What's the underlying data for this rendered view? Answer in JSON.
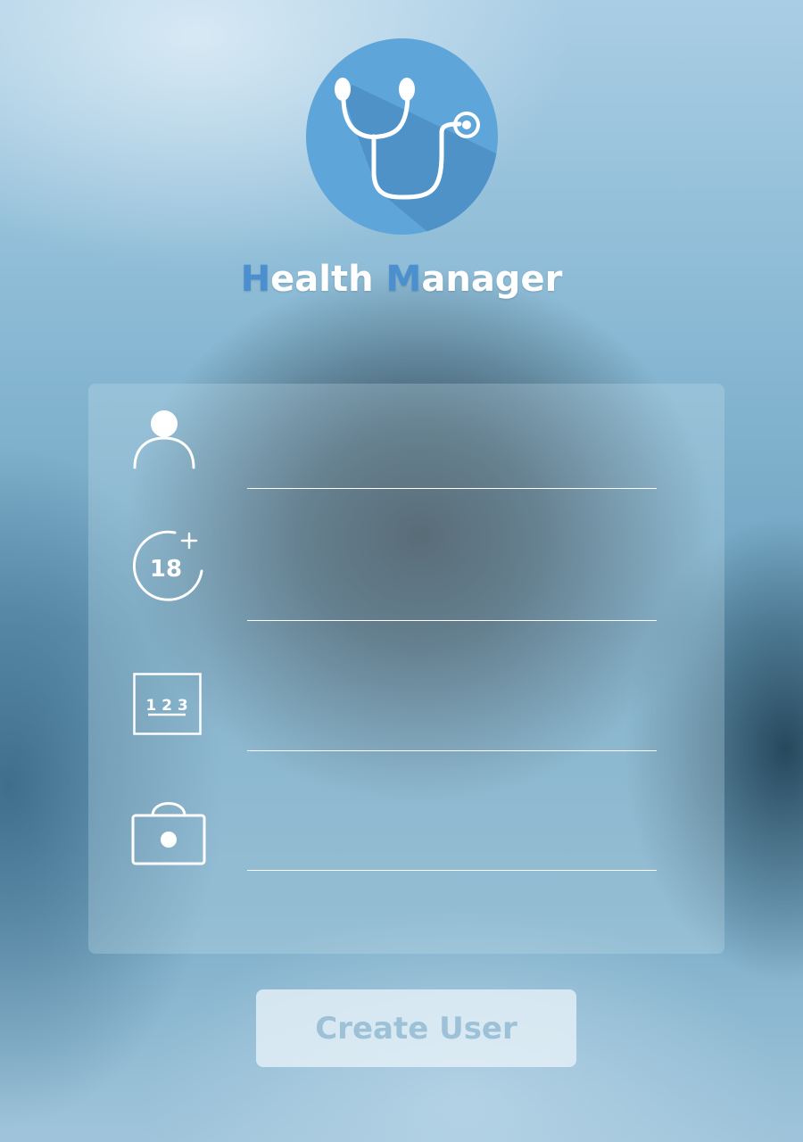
{
  "app": {
    "title_initial_1": "H",
    "title_rest_1": "ealth ",
    "title_initial_2": "M",
    "title_rest_2": "anager"
  },
  "form": {
    "fields": [
      {
        "icon": "user-icon",
        "value": "",
        "placeholder": ""
      },
      {
        "icon": "age-18-plus-icon",
        "icon_text": "18",
        "value": "",
        "placeholder": ""
      },
      {
        "icon": "number-pad-icon",
        "icon_text": "1 2 3",
        "value": "",
        "placeholder": ""
      },
      {
        "icon": "lock-icon",
        "value": "",
        "placeholder": ""
      }
    ]
  },
  "actions": {
    "create_label": "Create User"
  },
  "colors": {
    "logo_circle": "#5ea6da",
    "logo_shadow": "#4a8cc4",
    "title_accent": "#4b8fcf",
    "button_text": "#9dc1d7"
  }
}
